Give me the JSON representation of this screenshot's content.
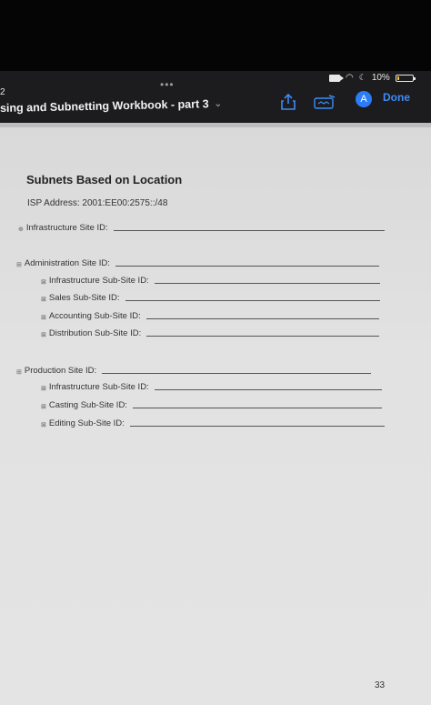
{
  "status": {
    "time": "2",
    "battery": "10%"
  },
  "toolbar": {
    "title": "sing and Subnetting Workbook - part 3",
    "done_label": "Done",
    "avatar_letter": "A"
  },
  "doc": {
    "title": "Subnets Based on Location",
    "isp": "ISP Address: 2001:EE00:2575::/48",
    "rows": [
      {
        "label": "Infrastructure Site ID:",
        "bullet": "⊕"
      },
      {
        "label": "Administration Site ID:",
        "bullet": "⊞"
      },
      {
        "label": "Infrastructure Sub-Site ID:",
        "bullet": "⊠"
      },
      {
        "label": "Sales Sub-Site ID:",
        "bullet": "⊠"
      },
      {
        "label": "Accounting Sub-Site ID:",
        "bullet": "⊠"
      },
      {
        "label": "Distribution Sub-Site ID:",
        "bullet": "⊠"
      },
      {
        "label": "Production Site ID:",
        "bullet": "⊞"
      },
      {
        "label": "Infrastructure Sub-Site ID:",
        "bullet": "⊠"
      },
      {
        "label": "Casting Sub-Site ID:",
        "bullet": "⊠"
      },
      {
        "label": "Editing Sub-Site ID:",
        "bullet": "⊠"
      }
    ],
    "page_number": "33"
  }
}
